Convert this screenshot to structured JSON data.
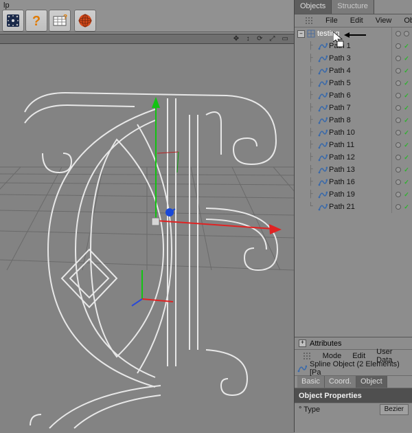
{
  "menu_fragment": "lp",
  "tabs": {
    "objects": "Objects",
    "structure": "Structure"
  },
  "om_menu": {
    "file": "File",
    "edit": "Edit",
    "view": "View",
    "objects": "Objects"
  },
  "tree_root": "testing",
  "tree_items": [
    {
      "label": "Path 1"
    },
    {
      "label": "Path 3"
    },
    {
      "label": "Path 4"
    },
    {
      "label": "Path 5"
    },
    {
      "label": "Path 6"
    },
    {
      "label": "Path 7"
    },
    {
      "label": "Path 8"
    },
    {
      "label": "Path 10"
    },
    {
      "label": "Path 11"
    },
    {
      "label": "Path 12"
    },
    {
      "label": "Path 13"
    },
    {
      "label": "Path 16"
    },
    {
      "label": "Path 19"
    },
    {
      "label": "Path 21"
    }
  ],
  "attributes": {
    "panel": "Attributes",
    "menu_mode": "Mode",
    "menu_edit": "Edit",
    "menu_user": "User Data",
    "title": "Spline Object (2 Elements) [Pa",
    "tab_basic": "Basic",
    "tab_coord": "Coord.",
    "tab_object": "Object",
    "section": "Object Properties",
    "prop_type_label": "° Type",
    "prop_type_value": "Bezier"
  },
  "viewport_icons": "✥ ↕ ⟳ ⤢ ▭"
}
